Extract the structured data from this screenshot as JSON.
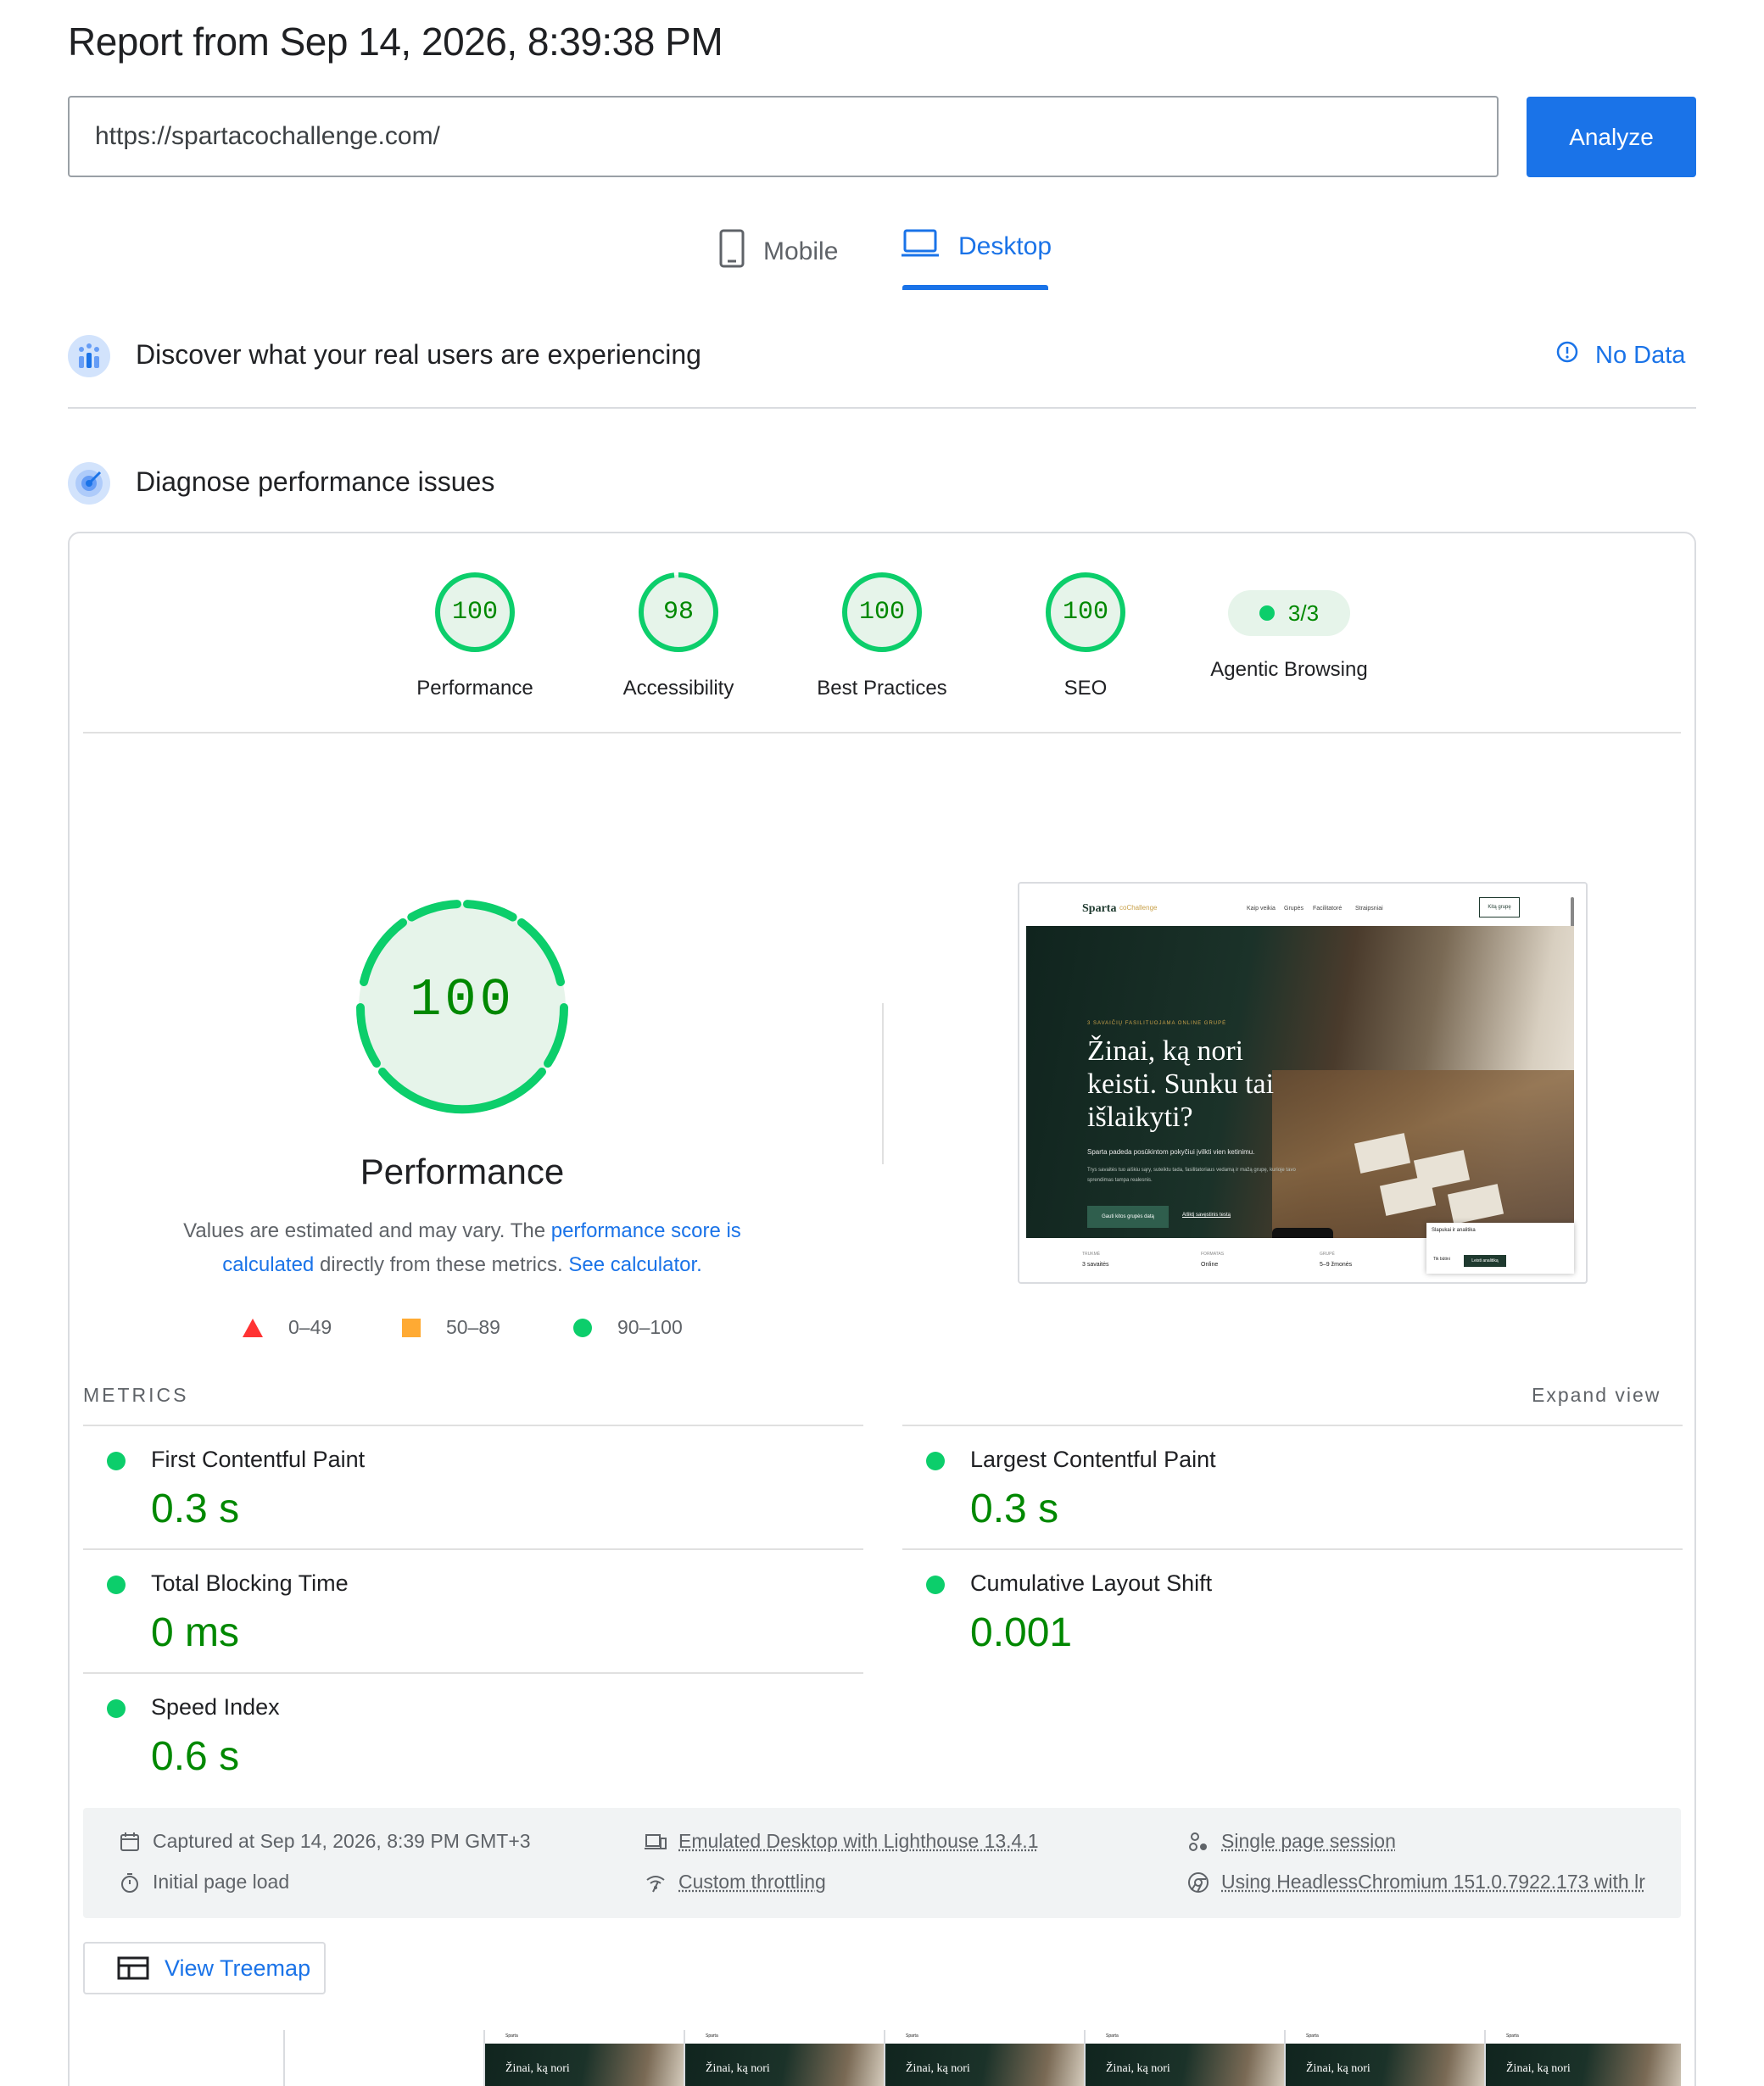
{
  "header": {
    "title": "Report from Sep 14, 2026, 8:39:38 PM",
    "url_value": "https://spartacochallenge.com/",
    "analyze_label": "Analyze"
  },
  "tabs": [
    {
      "label": "Mobile",
      "icon": "smartphone-icon",
      "active": false
    },
    {
      "label": "Desktop",
      "icon": "laptop-icon",
      "active": true
    }
  ],
  "crux": {
    "title": "Discover what your real users are experiencing",
    "status_label": "No Data"
  },
  "diagnose": {
    "title": "Diagnose performance issues"
  },
  "scores": [
    {
      "label": "Performance",
      "value": "100",
      "score": 100
    },
    {
      "label": "Accessibility",
      "value": "98",
      "score": 98
    },
    {
      "label": "Best Practices",
      "value": "100",
      "score": 100
    },
    {
      "label": "SEO",
      "value": "100",
      "score": 100
    }
  ],
  "agentic": {
    "label": "Agentic Browsing",
    "value": "3/3"
  },
  "performance": {
    "score": "100",
    "label": "Performance",
    "desc_prefix": "Values are estimated and may vary. The ",
    "desc_link1": "performance score is calculated",
    "desc_middle": " directly from these metrics. ",
    "desc_link2": "See calculator."
  },
  "legend": {
    "fail": "0–49",
    "average": "50–89",
    "pass": "90–100"
  },
  "colors": {
    "pass": "#0cce6b",
    "pass_text": "#008800",
    "average": "#ffaa33",
    "fail": "#ff3333",
    "accent": "#1a73e8"
  },
  "screenshot": {
    "brand": "Sparta",
    "brand_sub": "coChallenge",
    "nav": [
      "Kaip veikia",
      "Grupės",
      "Facilitatorė",
      "Straipsniai"
    ],
    "cta": "Kitą grupę",
    "eyebrow": "3 SAVAIČIŲ FASILITUOJAMA ONLINE GRUPĖ",
    "headline": "Žinai, ką nori keisti. Sunku tai išlaikyti?",
    "sub": "Sparta padeda posūkintom pokyčiui įvilkti vien ketinimu.",
    "body": "Trys savaitės tuo aiškiu sąry, suteiktu tada, fasilitatoriaus vedamą ir mažą grupę, kurioje tavo sprendimas tampa realesnis.",
    "btn_primary": "Gauti kitos grupės datą",
    "btn_link": "Atliktį savęstinis testą",
    "footer": [
      {
        "label": "TRUKMĖ",
        "value": "3 savaitės"
      },
      {
        "label": "FORMATAS",
        "value": "Online"
      },
      {
        "label": "GRUPĖ",
        "value": "5–9 žmonės"
      }
    ],
    "popup_title": "Slapukai ir analitika",
    "popup_alt": "Tik būtini",
    "popup_btn": "Leisti analitiką"
  },
  "metrics": {
    "heading": "METRICS",
    "expand_label": "Expand view",
    "items": [
      {
        "title": "First Contentful Paint",
        "value": "0.3 s"
      },
      {
        "title": "Largest Contentful Paint",
        "value": "0.3 s"
      },
      {
        "title": "Total Blocking Time",
        "value": "0 ms"
      },
      {
        "title": "Cumulative Layout Shift",
        "value": "0.001"
      },
      {
        "title": "Speed Index",
        "value": "0.6 s"
      }
    ]
  },
  "runtime": {
    "captured": "Captured at Sep 14, 2026, 8:39 PM GMT+3",
    "page_load": "Initial page load",
    "emulated": "Emulated Desktop with Lighthouse 13.4.1",
    "throttling": "Custom throttling",
    "session": "Single page session",
    "browser": "Using HeadlessChromium 151.0.7922.173 with lr"
  },
  "treemap_label": "View Treemap",
  "filmstrip": {
    "frame_text": "Žinai, ką nori",
    "frame_brand": "Sparta"
  }
}
